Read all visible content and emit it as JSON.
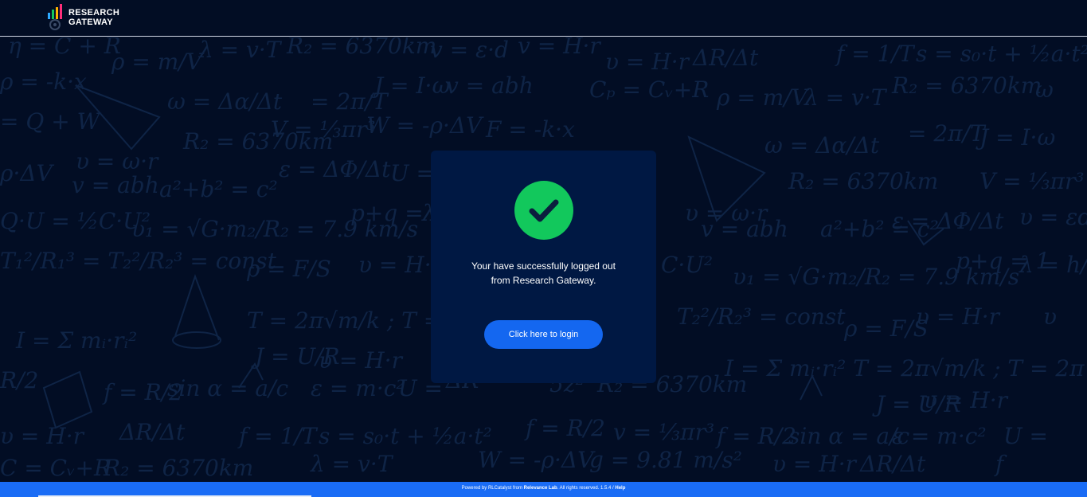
{
  "header": {
    "logo_line1": "RESEARCH",
    "logo_line2": "GATEWAY"
  },
  "card": {
    "message_line1": "Your have successfully logged out",
    "message_line2": "from Research Gateway.",
    "login_button": "Click here to login"
  },
  "footer": {
    "prefix": "Powered by RLCatalyst from ",
    "company": "Relevance Lab",
    "suffix": ". All rights reserved. 1.5.4 / ",
    "help": "Help"
  },
  "icons": {
    "logo": "bar-chart-logo-icon",
    "status": "check-circle-icon"
  },
  "colors": {
    "background": "#020d24",
    "card": "#001843",
    "success": "#12c85c",
    "button": "#1467f0",
    "footer": "#1a6cf5"
  }
}
